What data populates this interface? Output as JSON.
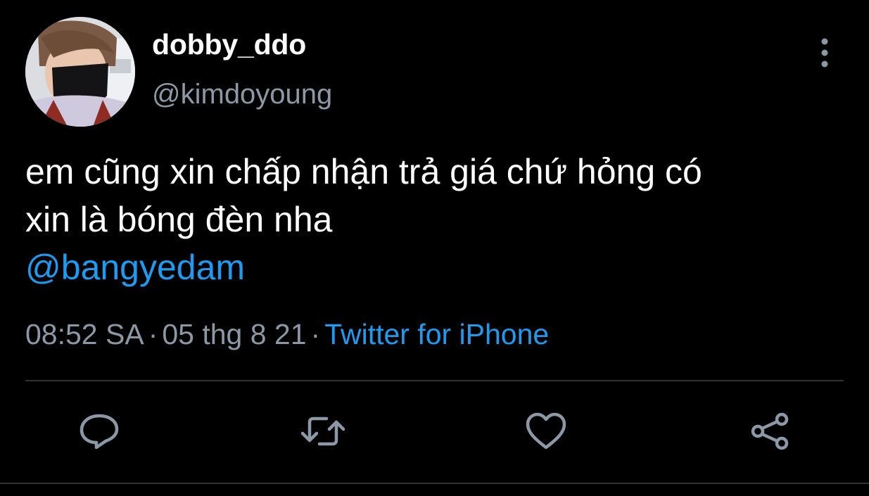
{
  "author": {
    "display_name": "dobby_ddo",
    "handle": "@kimdoyoung",
    "avatar_icon": "profile-photo"
  },
  "tweet": {
    "text_lines": [
      "em cũng xin chấp nhận trả giá chứ hỏng có",
      "xin là bóng đèn nha"
    ],
    "mention": "@bangyedam"
  },
  "meta": {
    "time": "08:52 SA",
    "date": "05 thg 8 21",
    "separator": "·",
    "source": "Twitter for iPhone"
  },
  "actions": [
    {
      "name": "reply",
      "icon": "speech-bubble-icon"
    },
    {
      "name": "retweet",
      "icon": "retweet-icon"
    },
    {
      "name": "like",
      "icon": "heart-icon"
    },
    {
      "name": "share",
      "icon": "share-icon"
    }
  ],
  "colors": {
    "background": "#000000",
    "text_primary": "#ffffff",
    "text_secondary": "#8b98a5",
    "accent": "#1d9bf0",
    "divider": "#2f3336"
  }
}
